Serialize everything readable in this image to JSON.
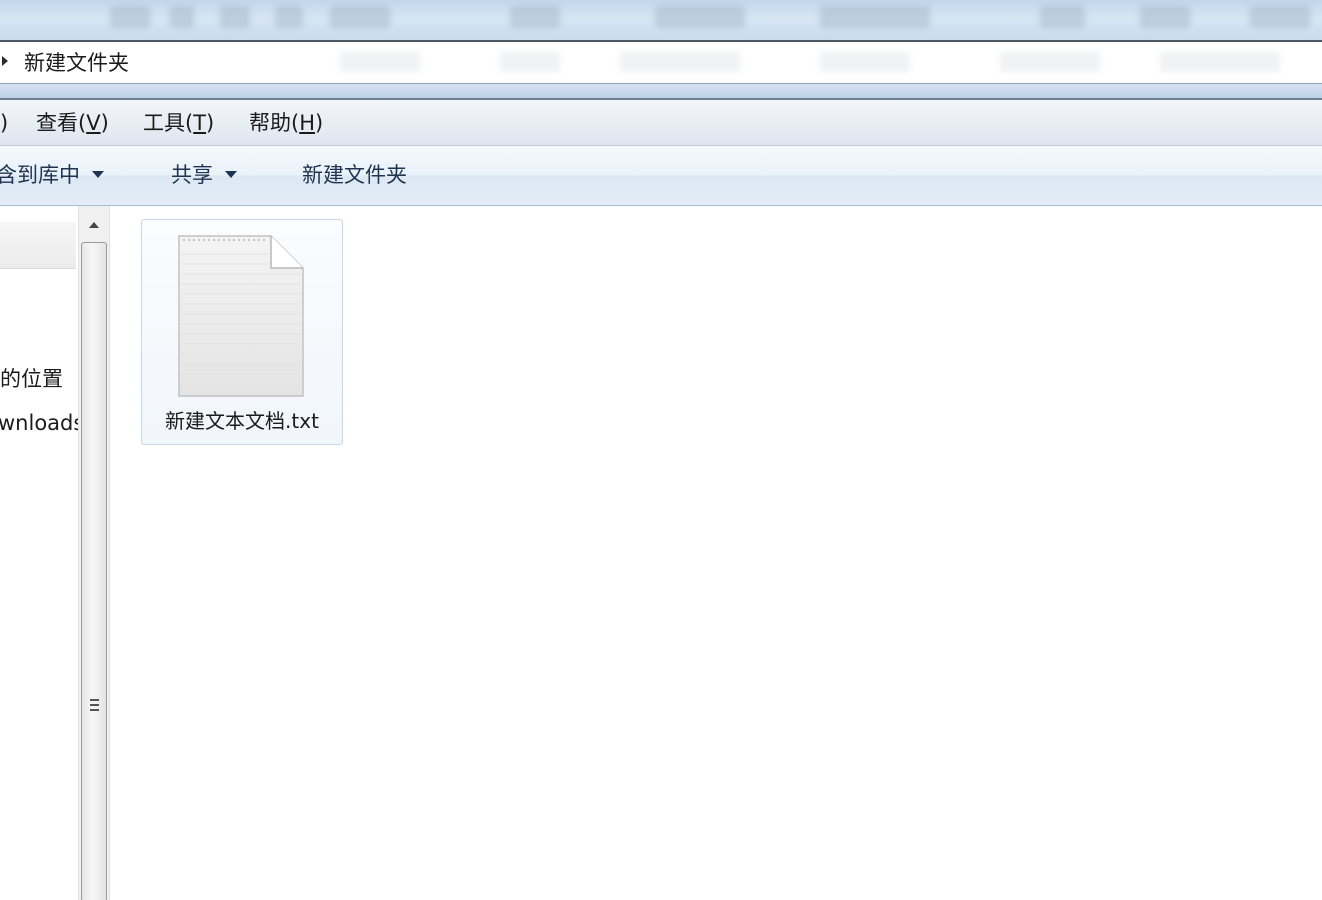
{
  "address_bar": {
    "current_folder": "新建文件夹"
  },
  "menu_bar": {
    "items": [
      {
        "text": ")"
      },
      {
        "text": "查看(",
        "mnemonic": "V",
        "close": ")"
      },
      {
        "text": "工具(",
        "mnemonic": "T",
        "close": ")"
      },
      {
        "text": "帮助(",
        "mnemonic": "H",
        "close": ")"
      }
    ]
  },
  "command_bar": {
    "include_in_library": "含到库中",
    "share": "共享",
    "new_folder": "新建文件夹"
  },
  "nav_pane": {
    "items": [
      {
        "label": "的位置"
      },
      {
        "label": "wnloads"
      }
    ]
  },
  "content": {
    "files": [
      {
        "name": "新建文本文档.txt",
        "icon": "text-document-icon"
      }
    ]
  },
  "colors": {
    "accent_border": "#c8d7e6",
    "glass": "#c9dbee",
    "command_text": "#1e3450"
  }
}
